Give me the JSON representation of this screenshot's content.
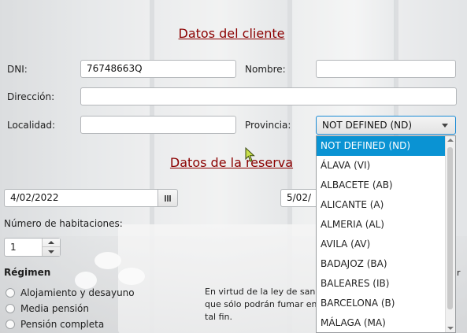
{
  "cliente": {
    "title": "Datos del cliente",
    "dni_label": "DNI:",
    "dni_value": "76748663Q",
    "nombre_label": "Nombre:",
    "nombre_value": "",
    "direccion_label": "Dirección:",
    "direccion_value": "",
    "localidad_label": "Localidad:",
    "localidad_value": "",
    "provincia_label": "Provincia:",
    "provincia_selected": "NOT DEFINED (ND)",
    "provincia_options": [
      "NOT DEFINED (ND)",
      "ÁLAVA (VI)",
      "ALBACETE (AB)",
      "ALICANTE (A)",
      "ALMERIA (AL)",
      "AVILA (AV)",
      "BADAJOZ (BA)",
      "BALEARES (IB)",
      "BARCELONA (B)",
      "MÁLAGA (MA)"
    ]
  },
  "reserva": {
    "title": "Datos de la reserva",
    "fecha_entrada": "4/02/2022",
    "fecha_salida": "5/02/",
    "habitaciones_label": "Número de habitaciones:",
    "habitaciones_value": "1",
    "regimen_label": "Régimen",
    "regimen_options": [
      "Alojamiento y desayuno",
      "Media pensión",
      "Pensión completa"
    ],
    "aviso_lines": [
      "En virtud de la ley de san",
      "que sólo podrán fumar en",
      "tal fin."
    ],
    "aviso_right_char": "r"
  },
  "colors": {
    "title": "#8b0000",
    "selection": "#0a93d3",
    "focus_border": "#1a8ad4"
  },
  "icons": {
    "calendar": "calendar-icon",
    "combo_arrow": "chevron-down-icon",
    "spinner": "spinner-arrows-icon",
    "cursor": "mouse-pointer-icon"
  }
}
